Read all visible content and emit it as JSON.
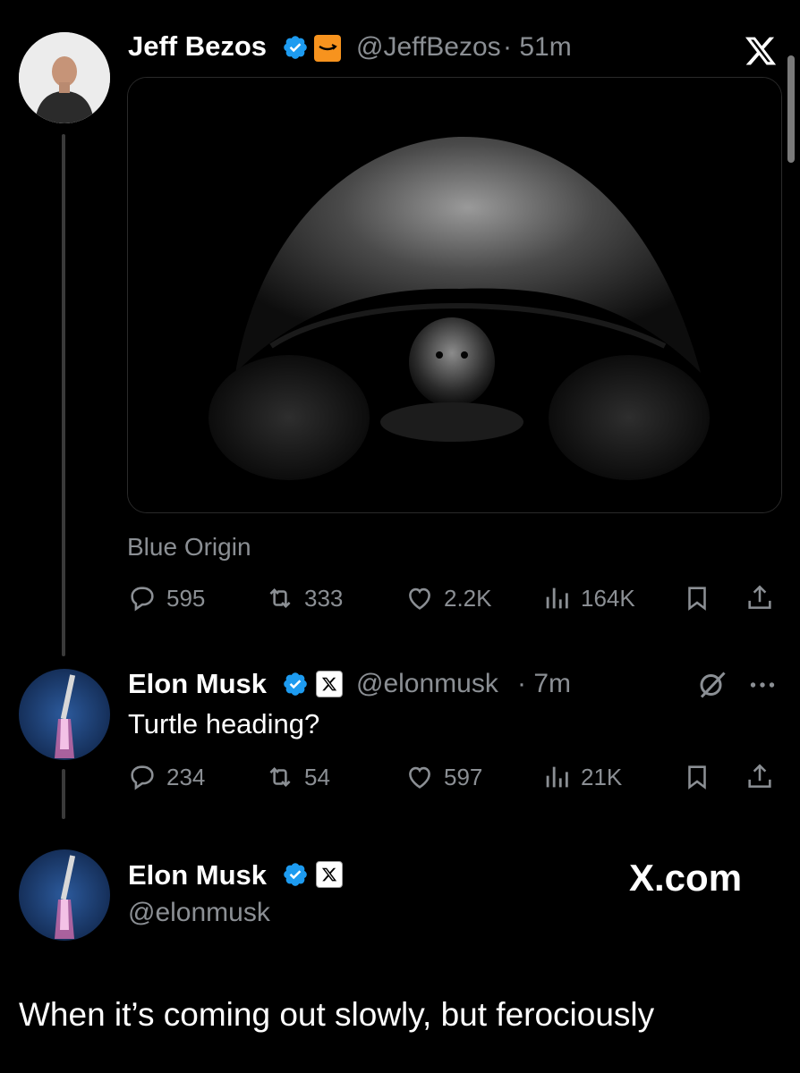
{
  "tweet1": {
    "name": "Jeff Bezos",
    "handle": "@JeffBezos",
    "time": "· 51m",
    "caption": "Blue Origin",
    "replies": "595",
    "retweets": "333",
    "likes": "2.2K",
    "views": "164K"
  },
  "tweet2": {
    "name": "Elon Musk",
    "handle": "@elonmusk",
    "time": "· 7m",
    "text": "Turtle heading?",
    "replies": "234",
    "retweets": "54",
    "likes": "597",
    "views": "21K"
  },
  "footer": {
    "name": "Elon Musk",
    "handle": "@elonmusk",
    "site": "X.com"
  },
  "caption_text": "When it’s coming out slowly, but ferociously",
  "colors": {
    "verified": "#1d9bf0",
    "amazon": "#f7931e",
    "background": "#000000",
    "muted": "#8b8f94"
  },
  "icons": [
    "close-x-icon",
    "verified-icon",
    "amazon-logo-icon",
    "x-logo-icon",
    "reply-icon",
    "retweet-icon",
    "like-icon",
    "views-icon",
    "bookmark-icon",
    "share-icon",
    "grok-icon",
    "more-icon"
  ]
}
